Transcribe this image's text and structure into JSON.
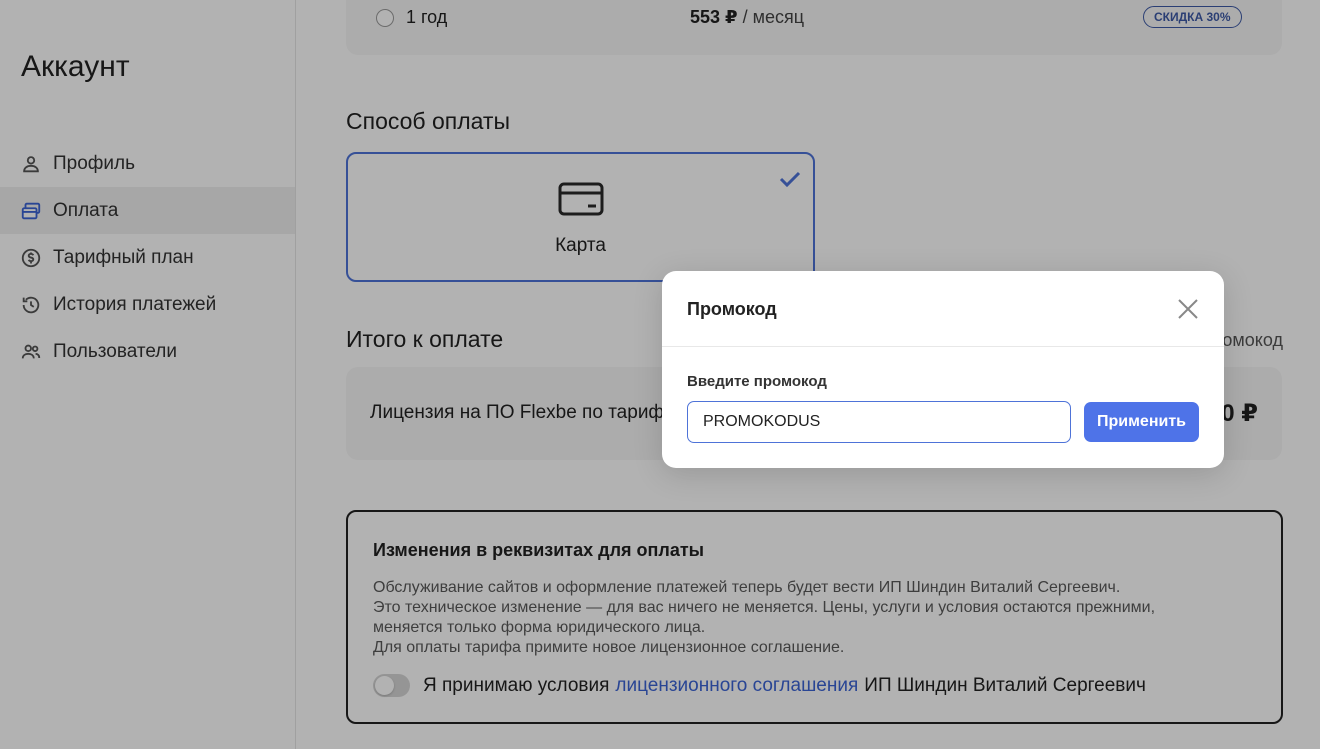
{
  "sidebar": {
    "title": "Аккаунт",
    "items": [
      {
        "label": "Профиль",
        "icon": "user-icon"
      },
      {
        "label": "Оплата",
        "icon": "payment-icon"
      },
      {
        "label": "Тарифный план",
        "icon": "dollar-icon"
      },
      {
        "label": "История платежей",
        "icon": "history-icon"
      },
      {
        "label": "Пользователи",
        "icon": "users-icon"
      }
    ],
    "active_index": 1
  },
  "plan": {
    "label": "1 год",
    "price": "553 ₽",
    "period": " / месяц",
    "badge": "СКИДКА 30%"
  },
  "payment": {
    "section_title": "Способ оплаты",
    "method_label": "Карта",
    "selected": true
  },
  "total": {
    "section_title": "Итого к оплате",
    "promo_link": "омокод",
    "description": "Лицензия на ПО Flexbe по тариф",
    "amount": "0 ₽"
  },
  "notice": {
    "title": "Изменения в реквизитах для оплаты",
    "lines": [
      "Обслуживание сайтов и оформление платежей теперь будет вести ИП Шиндин Виталий Сергеевич.",
      "Это техническое изменение — для вас ничего не меняется. Цены, услуги и условия остаются прежними,",
      "меняется только форма юридического лица.",
      "Для оплаты тарифа примите новое лицензионное соглашение."
    ],
    "agree_prefix": "Я принимаю условия",
    "agree_link": "лицензионного соглашения",
    "agree_suffix": "ИП Шиндин Виталий Сергеевич",
    "agree_checked": false
  },
  "modal": {
    "title": "Промокод",
    "field_label": "Введите промокод",
    "input_value": "PROMOKODUS",
    "apply_label": "Применить"
  },
  "colors": {
    "accent": "#4e73e8",
    "link": "#3b63d4",
    "badge": "#3d5aa6"
  }
}
